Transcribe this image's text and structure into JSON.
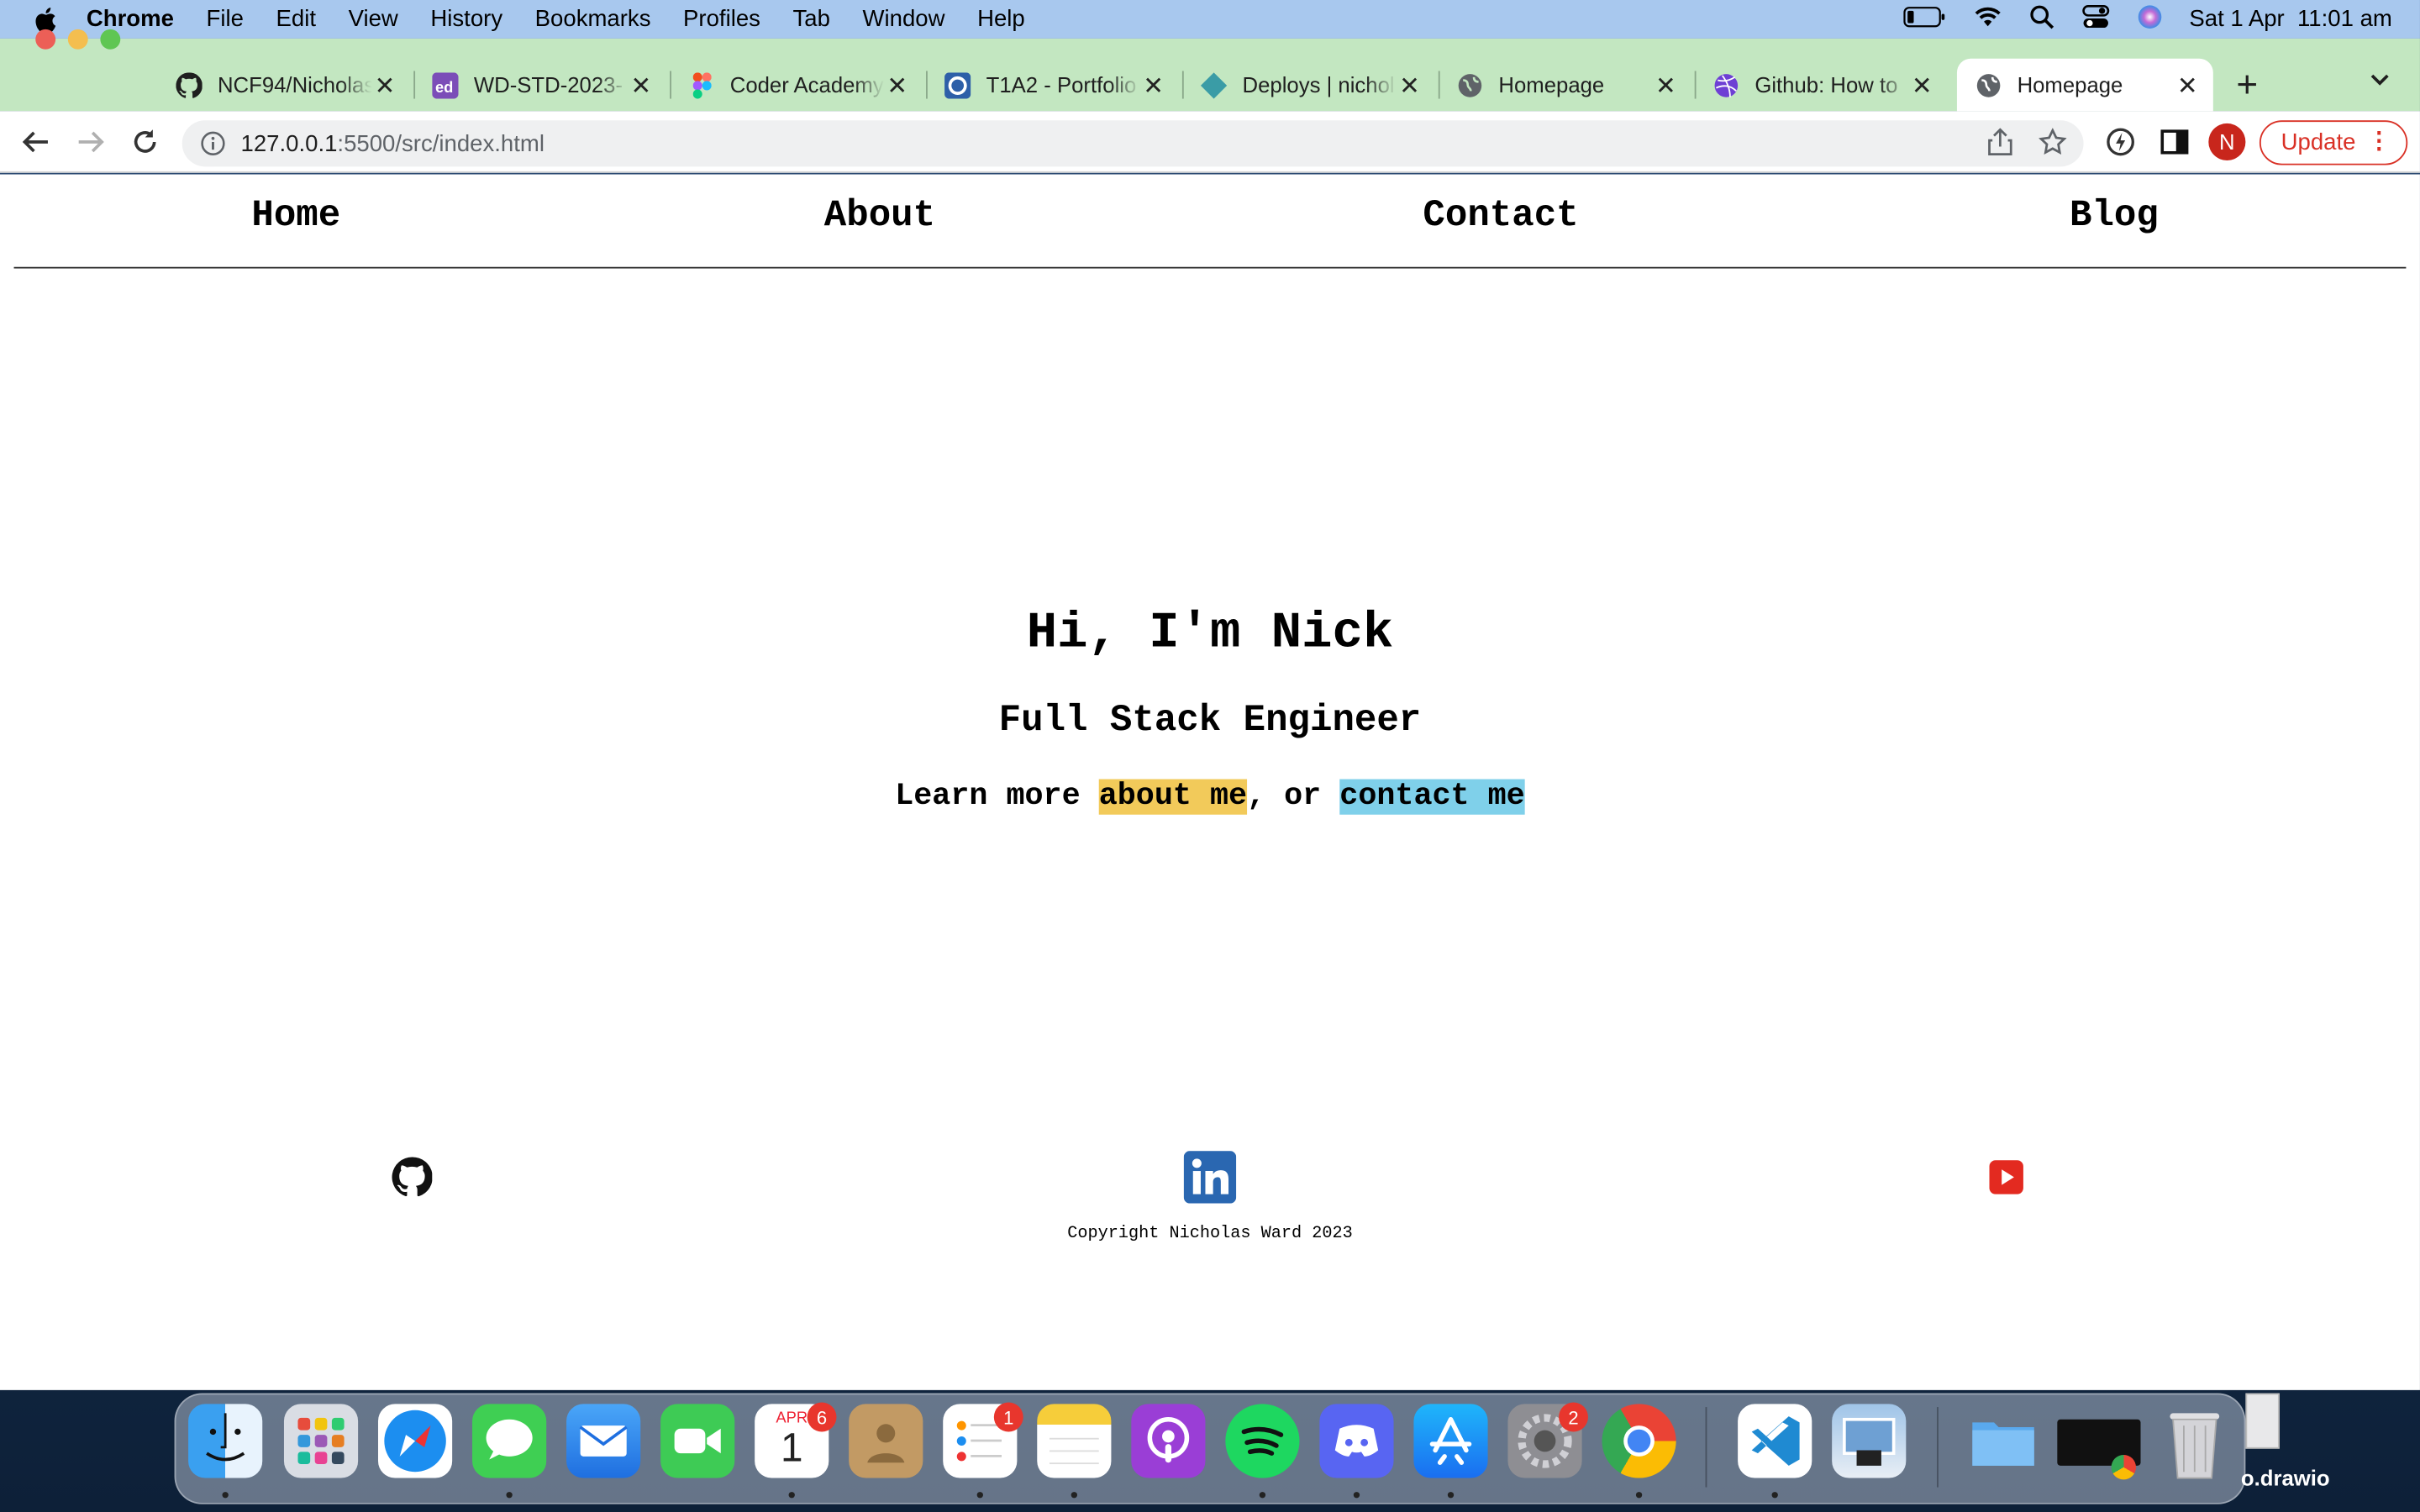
{
  "menubar": {
    "app_name": "Chrome",
    "items": [
      "File",
      "Edit",
      "View",
      "History",
      "Bookmarks",
      "Profiles",
      "Tab",
      "Window",
      "Help"
    ],
    "datetime": "Sat 1 Apr  11:01 am"
  },
  "tabs": [
    {
      "title": "NCF94/Nicholas",
      "icon": "github-icon"
    },
    {
      "title": "WD-STD-2023-",
      "icon": "ed-icon"
    },
    {
      "title": "Coder Academy",
      "icon": "figma-icon"
    },
    {
      "title": "T1A2 - Portfolio",
      "icon": "canvas-icon"
    },
    {
      "title": "Deploys | nichol",
      "icon": "netlify-icon"
    },
    {
      "title": "Homepage",
      "icon": "globe-icon"
    },
    {
      "title": "Github: How to",
      "icon": "dribbble-icon"
    },
    {
      "title": "Homepage",
      "icon": "globe-icon"
    }
  ],
  "toolbar": {
    "url_host": "127.0.0.1",
    "url_rest": ":5500/src/index.html",
    "profile_initial": "N",
    "update_label": "Update"
  },
  "site": {
    "nav": [
      "Home",
      "About",
      "Contact",
      "Blog"
    ],
    "heading": "Hi, I'm Nick",
    "subheading": "Full Stack Engineer",
    "lead_prefix": "Learn more ",
    "about_link": "about me",
    "lead_middle": ", or ",
    "contact_link": "contact me",
    "copyright": "Copyright Nicholas Ward 2023",
    "colors": {
      "about_highlight": "#f2ca5a",
      "contact_highlight": "#7fd0ea"
    }
  },
  "dock": {
    "calendar_month": "APR",
    "calendar_day": "1",
    "calendar_badge": "6",
    "reminders_badge": "1",
    "settings_badge": "2",
    "desktop_label": "o.drawio"
  }
}
